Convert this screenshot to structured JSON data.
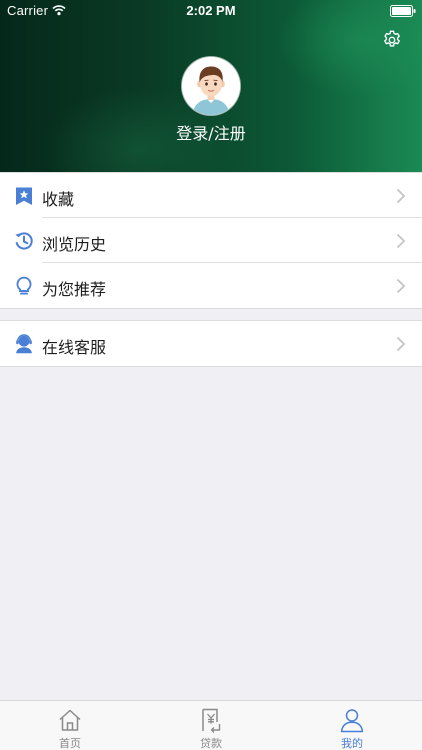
{
  "status_bar": {
    "carrier": "Carrier",
    "time": "2:02 PM"
  },
  "header": {
    "login_text": "登录/注册",
    "avatar_icon": "avatar-icon",
    "settings_icon": "gear-icon"
  },
  "menu": {
    "items": [
      {
        "label": "收藏",
        "icon": "star-bookmark-icon"
      },
      {
        "label": "浏览历史",
        "icon": "history-icon"
      },
      {
        "label": "为您推荐",
        "icon": "lightbulb-icon"
      }
    ],
    "service": {
      "label": "在线客服",
      "icon": "customer-service-icon"
    }
  },
  "tabbar": {
    "tabs": [
      {
        "label": "首页",
        "icon": "home-icon"
      },
      {
        "label": "贷款",
        "icon": "loan-document-icon"
      },
      {
        "label": "我的",
        "icon": "user-icon"
      }
    ],
    "active_index": 2
  },
  "colors": {
    "accent": "#4a7fd6",
    "header_dark": "#05281a",
    "header_light": "#1b8a54",
    "page_background": "#efeff4",
    "inactive_tab": "#8a8a8a"
  }
}
